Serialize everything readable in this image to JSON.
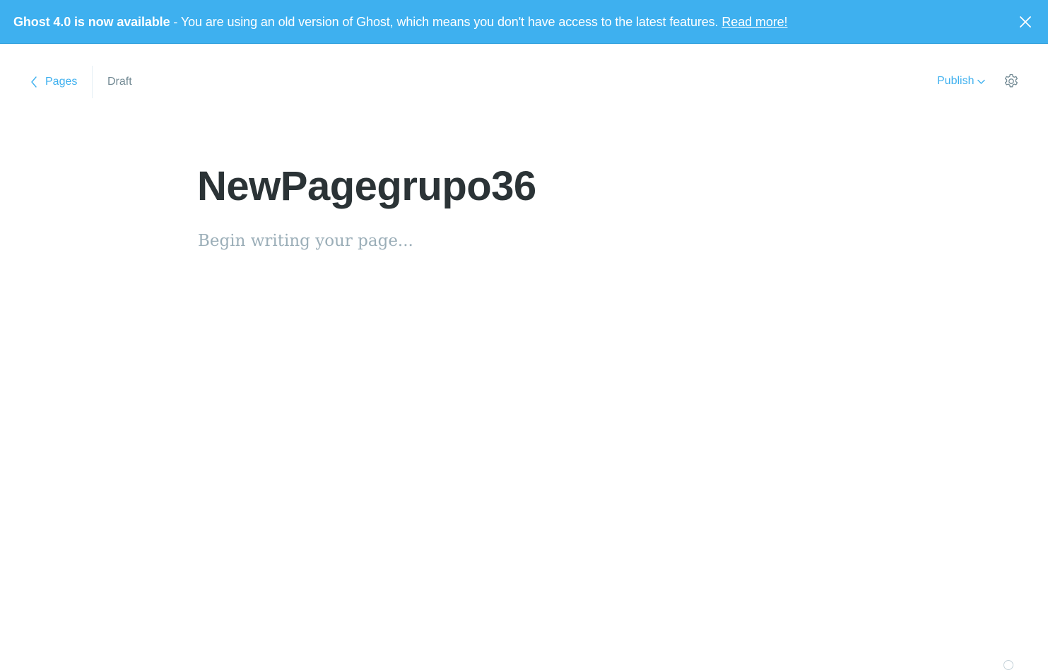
{
  "banner": {
    "strong": "Ghost 4.0 is now available",
    "message": " - You are using an old version of Ghost, which means you don't have access to the latest features. ",
    "link": "Read more!",
    "close_icon": "close-icon",
    "background": "#3eb0ef"
  },
  "header": {
    "back_label": "Pages",
    "back_icon": "chevron-left-icon",
    "status": "Draft",
    "publish_label": "Publish",
    "publish_icon": "chevron-down-icon",
    "settings_icon": "gear-icon"
  },
  "editor": {
    "title": "NewPagegrupo36",
    "body_placeholder": "Begin writing your page..."
  },
  "colors": {
    "accent": "#3eb0ef",
    "title": "#2b3336",
    "muted": "#738a94",
    "placeholder": "#9baeb8"
  }
}
